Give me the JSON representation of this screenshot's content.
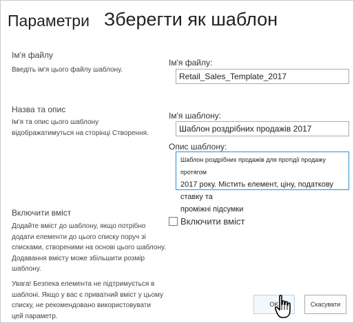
{
  "header": {
    "parent_title": "Параметри",
    "page_title": "Зберегти як шаблон"
  },
  "file_section": {
    "heading": "Ім'я файлу",
    "description": "Введіть ім'я цього файлу шаблону.",
    "field_label": "Ім'я файлу:",
    "field_value": "Retail_Sales_Template_2017"
  },
  "name_section": {
    "heading": "Назва та опис",
    "description_lines": [
      "Ім'я та опис цього шаблону",
      "відображатимуться на сторінці Створення."
    ],
    "name_label": "Ім'я шаблону:",
    "name_value": "Шаблон роздрібних продажів 2017",
    "desc_label": "Опис шаблону:",
    "desc_lines": [
      "Шаблон роздрібних продажів для протідії продажу протягом",
      "2017 року. Містить елемент, ціну, податкову ставку та",
      "проміжні підсумки"
    ]
  },
  "content_section": {
    "heading": "Включити вміст",
    "description_lines": [
      "Додайте вміст до шаблону, якщо потрібно",
      "додати елементи до цього списку поруч зі",
      "списками, створеними на основі цього шаблону.",
      "Додавання вмісту може збільшити розмір",
      "шаблону."
    ],
    "warning_lines": [
      "Увага! Безпека елемента не підтримується в",
      "шаблоні. Якщо у вас є приватний вміст у цьому",
      "списку, не рекомендовано використовувати",
      "цей параметр."
    ],
    "checkbox_label": "Включити вміст",
    "checkbox_checked": false
  },
  "buttons": {
    "ok_label": "OK",
    "cancel_label": "Скасувати"
  },
  "colors": {
    "textarea_border": "#2a8dd4",
    "input_border": "#ababab"
  },
  "icons": {
    "cursor": "hand-pointer-icon"
  }
}
